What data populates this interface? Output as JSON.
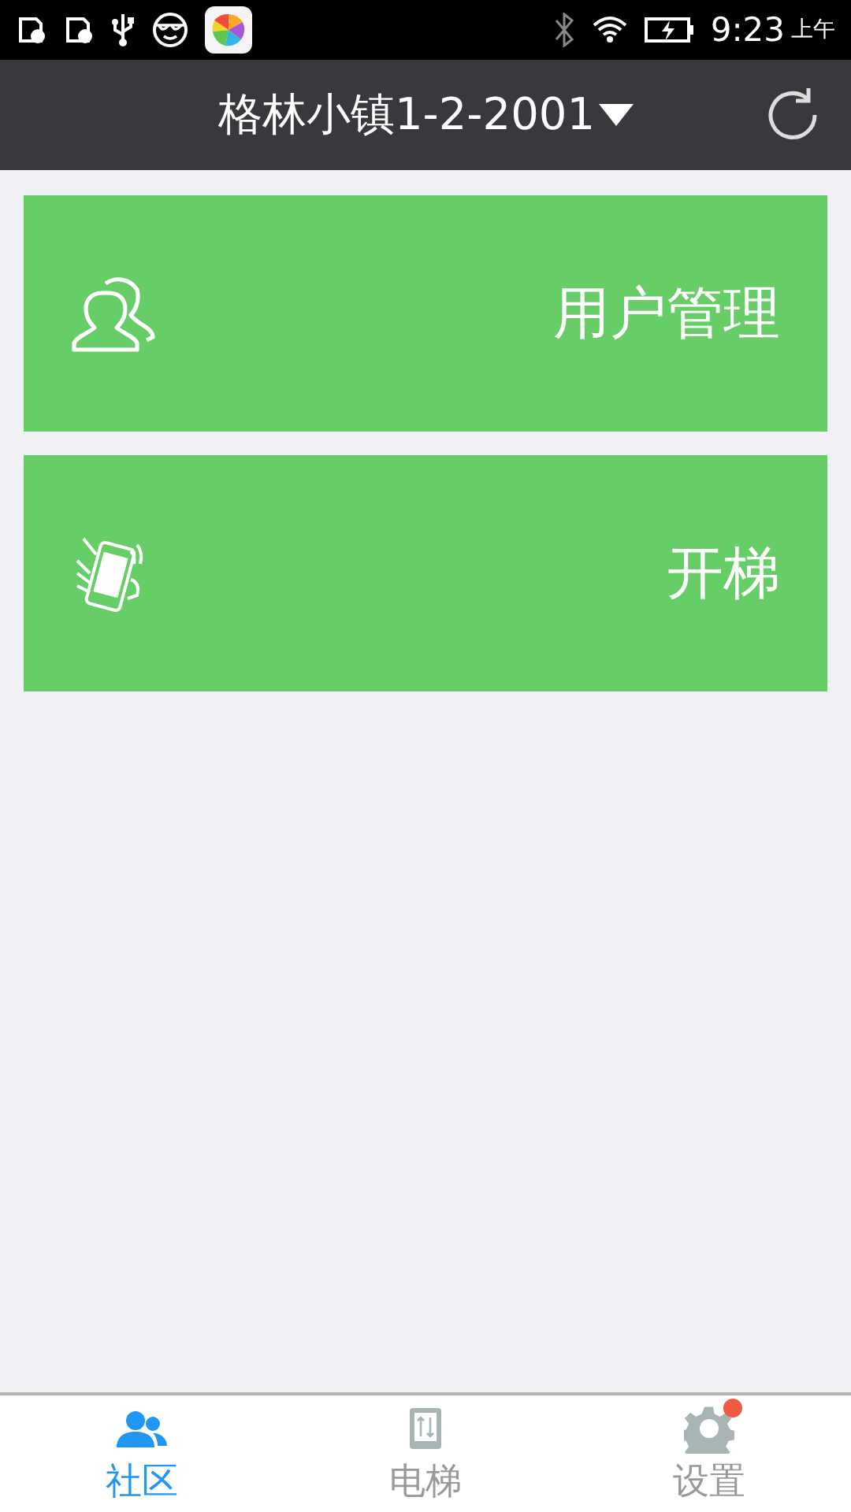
{
  "status_bar": {
    "time": "9:23",
    "period": "上午"
  },
  "header": {
    "title": "格林小镇1-2-2001"
  },
  "tiles": [
    {
      "kind": "users",
      "label": "用户管理"
    },
    {
      "kind": "phone",
      "label": "开梯"
    }
  ],
  "tabs": [
    {
      "kind": "community",
      "label": "社区",
      "selected": true,
      "badge": false
    },
    {
      "kind": "elevator",
      "label": "电梯",
      "selected": false,
      "badge": false
    },
    {
      "kind": "settings",
      "label": "设置",
      "selected": false,
      "badge": true
    }
  ]
}
